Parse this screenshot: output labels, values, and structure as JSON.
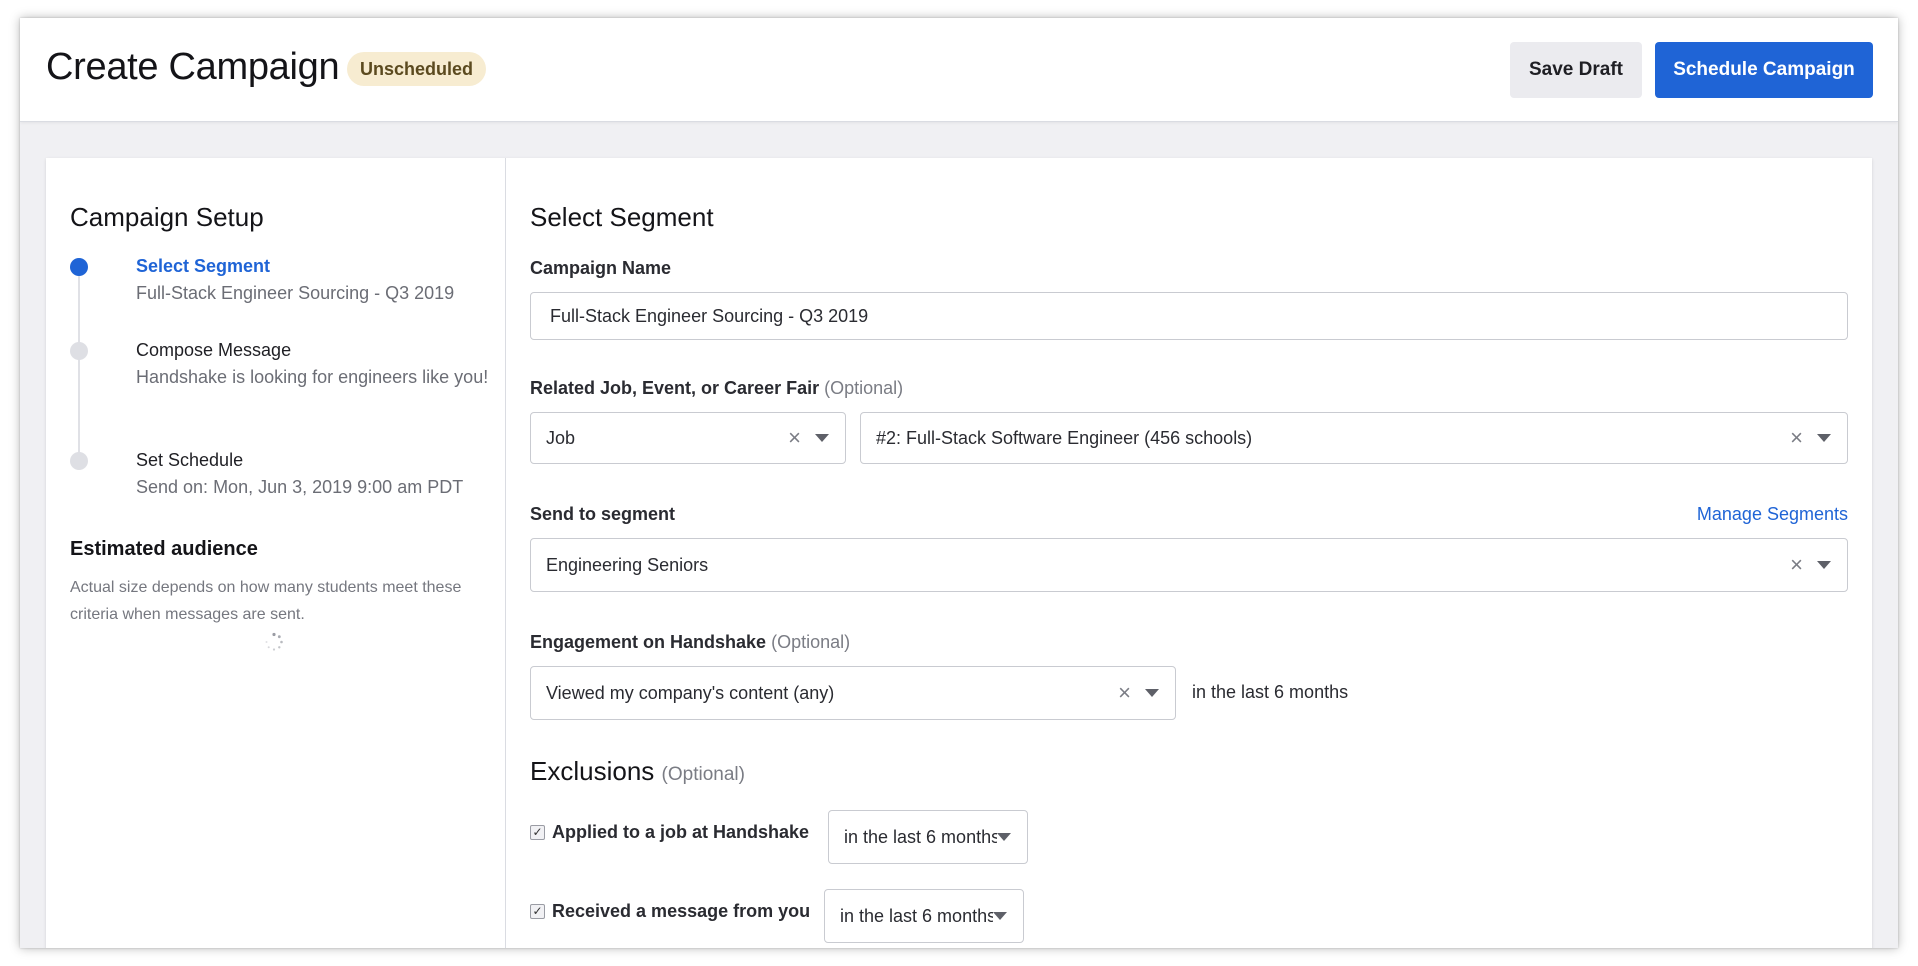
{
  "header": {
    "title": "Create Campaign",
    "status_badge": "Unscheduled",
    "save_draft_label": "Save Draft",
    "schedule_label": "Schedule Campaign"
  },
  "sidebar": {
    "title": "Campaign Setup",
    "steps": [
      {
        "title": "Select Segment",
        "desc": "Full-Stack Engineer Sourcing - Q3 2019",
        "active": true
      },
      {
        "title": "Compose Message",
        "desc": "Handshake is looking for engineers like you!",
        "active": false
      },
      {
        "title": "Set Schedule",
        "desc": "Send on: Mon, Jun 3, 2019 9:00 am PDT",
        "active": false
      }
    ],
    "audience_title": "Estimated audience",
    "audience_desc": "Actual size depends on how many students meet these criteria when messages are sent."
  },
  "form": {
    "section_title": "Select Segment",
    "campaign_name_label": "Campaign Name",
    "campaign_name_value": "Full-Stack Engineer Sourcing - Q3 2019",
    "related_label": "Related Job, Event, or Career Fair",
    "optional_text": "(Optional)",
    "related_type_value": "Job",
    "related_item_value": "#2: Full-Stack Software Engineer (456 schools)",
    "segment_label": "Send to segment",
    "manage_segments_link": "Manage Segments",
    "segment_value": "Engineering Seniors",
    "engagement_label": "Engagement on Handshake",
    "engagement_value": "Viewed my company's content (any)",
    "engagement_suffix": "in the last 6 months",
    "exclusions_title": "Exclusions",
    "exclusions": [
      {
        "label": "Applied to a job at Handshake",
        "checked": true,
        "period": "in the last 6 months"
      },
      {
        "label": "Received a message from you",
        "checked": true,
        "period": "in the last 6 months"
      }
    ]
  },
  "colors": {
    "accent": "#1f64d6",
    "badge_bg": "#f7ecd1",
    "badge_text": "#5b4a1f"
  }
}
